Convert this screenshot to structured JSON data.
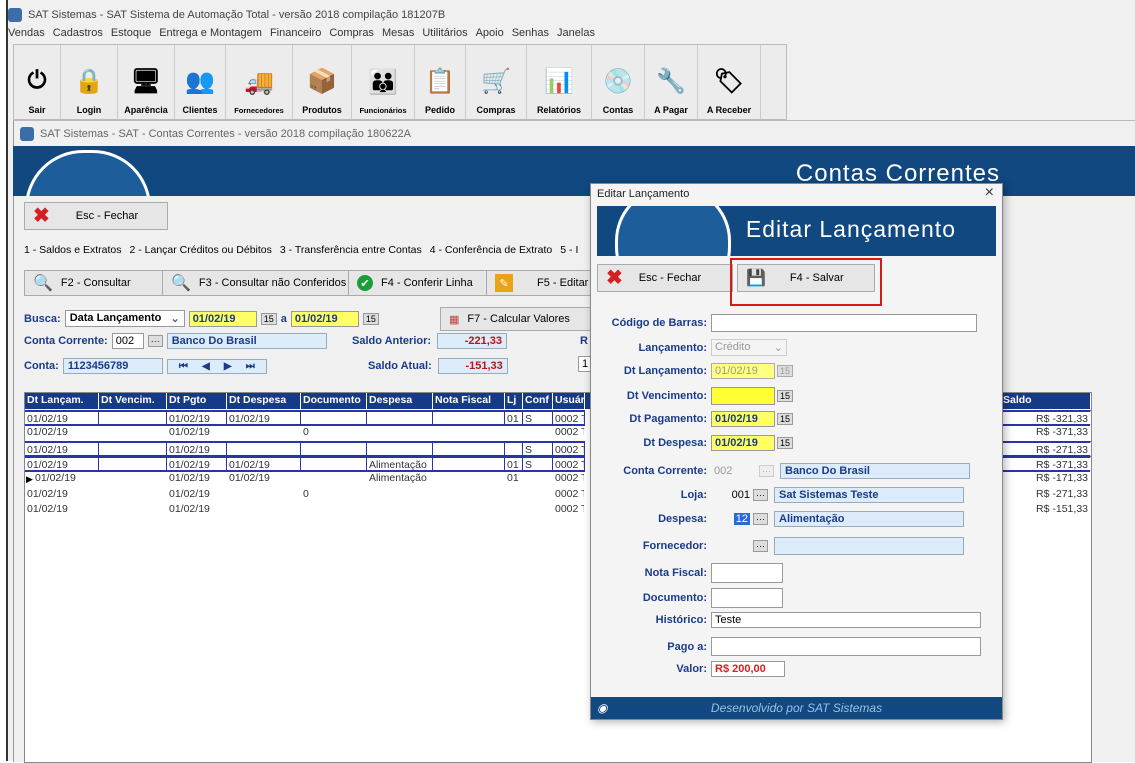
{
  "app": {
    "title": "SAT Sistemas - SAT Sistema de Automação Total - versão 2018 compilação 181207B",
    "menu": [
      "Vendas",
      "Cadastros",
      "Estoque",
      "Entrega e Montagem",
      "Financeiro",
      "Compras",
      "Mesas",
      "Utilitários",
      "Apoio",
      "Senhas",
      "Janelas"
    ],
    "toolbar": [
      {
        "label": "Sair",
        "icon": "power-icon"
      },
      {
        "label": "Login",
        "icon": "login-icon"
      },
      {
        "label": "Aparência",
        "icon": "monitor-icon"
      },
      {
        "label": "Clientes",
        "icon": "clients-icon"
      },
      {
        "label": "Fornecedores",
        "icon": "truck-icon"
      },
      {
        "label": "Produtos",
        "icon": "box-icon"
      },
      {
        "label": "Funcionários",
        "icon": "employees-icon"
      },
      {
        "label": "Pedido",
        "icon": "order-icon"
      },
      {
        "label": "Compras",
        "icon": "purchase-icon"
      },
      {
        "label": "Relatórios",
        "icon": "report-icon"
      },
      {
        "label": "Contas",
        "icon": "accounts-icon"
      },
      {
        "label": "A Pagar",
        "icon": "payable-icon"
      },
      {
        "label": "A Receber",
        "icon": "receivable-icon"
      }
    ]
  },
  "child": {
    "title": "SAT Sistemas - SAT - Contas Correntes - versão 2018 compilação 180622A",
    "banner_title": "Contas Correntes",
    "close_label": "Esc - Fechar",
    "tabs": [
      "1 - Saldos e Extratos",
      "2 - Lançar Créditos ou Débitos",
      "3 - Transferência entre Contas",
      "4 - Conferência de Extrato",
      "5 - I"
    ],
    "buttons": {
      "consultar": "F2 - Consultar",
      "consultar_nc": "F3 - Consultar não Conferidos",
      "conferir": "F4 - Conferir Linha",
      "editar": "F5 - Editar",
      "calcular": "F7 - Calcular Valores"
    },
    "busca": {
      "label": "Busca:",
      "field": "Data Lançamento",
      "from": "01/02/19",
      "to_sep": "a",
      "to": "01/02/19"
    },
    "conta_corrente": {
      "label": "Conta Corrente:",
      "code": "002",
      "name": "Banco Do Brasil"
    },
    "conta": {
      "label": "Conta:",
      "value": "1123456789"
    },
    "saldo_anterior": {
      "label": "Saldo Anterior:",
      "value": "-221,33"
    },
    "saldo_atual": {
      "label": "Saldo Atual:",
      "value": "-151,33"
    },
    "side_r": "R",
    "side_1": "1"
  },
  "grid": {
    "columns": [
      "Dt Lançam.",
      "Dt Vencim.",
      "Dt Pgto",
      "Dt Despesa",
      "Documento",
      "Despesa",
      "Nota Fiscal",
      "Lj",
      "Conf",
      "Usuári"
    ],
    "saldo_header": "Saldo",
    "rows": [
      {
        "c": [
          "01/02/19",
          "",
          "01/02/19",
          "01/02/19",
          "",
          "",
          "",
          "01",
          "S",
          "0002 Te"
        ],
        "saldo": "R$ -321,33",
        "sel": true
      },
      {
        "c": [
          "01/02/19",
          "",
          "01/02/19",
          "",
          "0",
          "",
          "",
          "",
          "",
          "0002 Te"
        ],
        "saldo": "R$ -371,33",
        "sel": false
      },
      {
        "c": [
          "01/02/19",
          "",
          "01/02/19",
          "",
          "",
          "",
          "",
          "",
          "S",
          "0002 Te"
        ],
        "saldo": "R$ -271,33",
        "sel": true
      },
      {
        "c": [
          "01/02/19",
          "",
          "01/02/19",
          "01/02/19",
          "",
          "Alimentação",
          "",
          "01",
          "S",
          "0002 Te"
        ],
        "saldo": "R$ -371,33",
        "sel": true
      },
      {
        "c": [
          "01/02/19",
          "",
          "01/02/19",
          "01/02/19",
          "",
          "Alimentação",
          "",
          "01",
          "",
          "0002 Te"
        ],
        "saldo": "R$ -171,33",
        "sel": false
      },
      {
        "c": [
          "01/02/19",
          "",
          "01/02/19",
          "",
          "0",
          "",
          "",
          "",
          "",
          "0002 Te"
        ],
        "saldo": "R$ -271,33",
        "sel": false
      },
      {
        "c": [
          "01/02/19",
          "",
          "01/02/19",
          "",
          "",
          "",
          "",
          "",
          "",
          "0002 Te"
        ],
        "saldo": "R$ -151,33",
        "sel": false
      }
    ]
  },
  "dialog": {
    "title": "Editar Lançamento",
    "banner_title": "Editar Lançamento",
    "close_label": "Esc - Fechar",
    "save_label": "F4 - Salvar",
    "fields": {
      "codigo_barras": {
        "label": "Código de Barras:",
        "value": ""
      },
      "lancamento": {
        "label": "Lançamento:",
        "value": "Crédito"
      },
      "dt_lancamento": {
        "label": "Dt Lançamento:",
        "value": "01/02/19"
      },
      "dt_vencimento": {
        "label": "Dt Vencimento:",
        "value": ""
      },
      "dt_pagamento": {
        "label": "Dt Pagamento:",
        "value": "01/02/19"
      },
      "dt_despesa": {
        "label": "Dt Despesa:",
        "value": "01/02/19"
      },
      "conta_corrente": {
        "label": "Conta Corrente:",
        "code": "002",
        "name": "Banco Do Brasil"
      },
      "loja": {
        "label": "Loja:",
        "code": "001",
        "name": "Sat Sistemas Teste"
      },
      "despesa": {
        "label": "Despesa:",
        "code": "12",
        "name": "Alimentação"
      },
      "fornecedor": {
        "label": "Fornecedor:",
        "value": ""
      },
      "nota_fiscal": {
        "label": "Nota Fiscal:",
        "value": ""
      },
      "documento": {
        "label": "Documento:",
        "value": ""
      },
      "historico": {
        "label": "Histórico:",
        "value": "Teste"
      },
      "pago_a": {
        "label": "Pago a:",
        "value": ""
      },
      "valor": {
        "label": "Valor:",
        "value": "R$ 200,00"
      }
    },
    "footer": "Desenvolvido por SAT Sistemas"
  }
}
